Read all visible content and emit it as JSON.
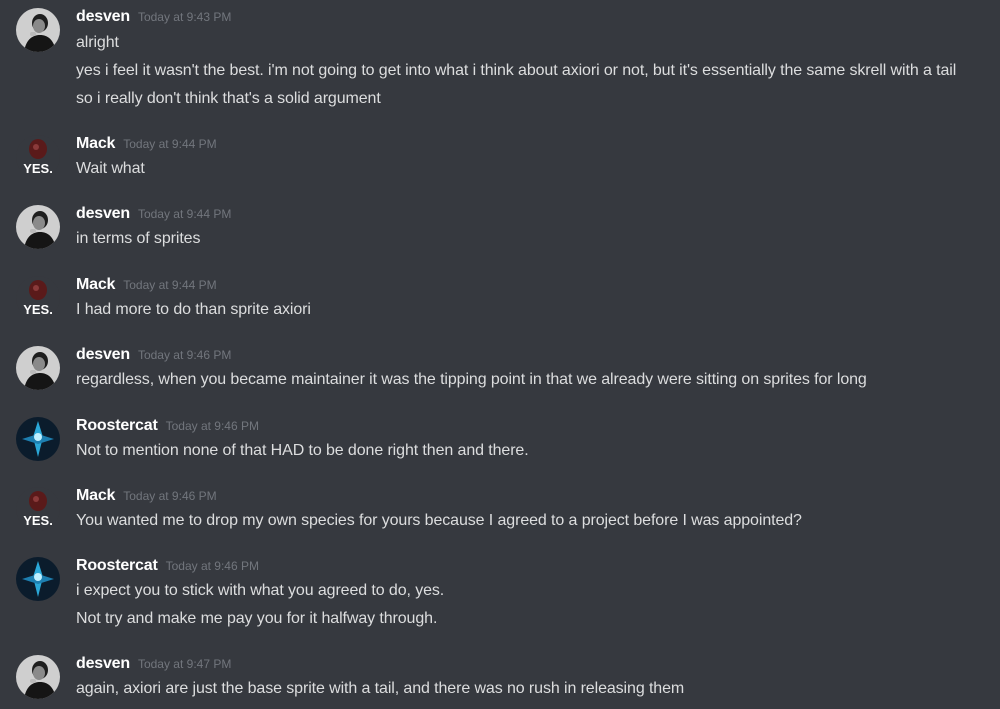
{
  "colors": {
    "background": "#36393f",
    "username": "#ffffff",
    "timestamp": "#72767d",
    "message_text": "#dcddde"
  },
  "messages": [
    {
      "author": "desven",
      "avatar_icon": "desven-avatar-icon",
      "timestamp": "Today at 9:43 PM",
      "lines": [
        "alright",
        "yes i feel it wasn't the best. i'm not going to get into what i think about axiori or not, but it's essentially the same skrell with a tail",
        "so i really don't think that's a solid argument"
      ]
    },
    {
      "author": "Mack",
      "avatar_icon": "mack-avatar-icon",
      "avatar_text": "YES.",
      "timestamp": "Today at 9:44 PM",
      "lines": [
        "Wait what"
      ]
    },
    {
      "author": "desven",
      "avatar_icon": "desven-avatar-icon",
      "timestamp": "Today at 9:44 PM",
      "lines": [
        "in terms of sprites"
      ]
    },
    {
      "author": "Mack",
      "avatar_icon": "mack-avatar-icon",
      "avatar_text": "YES.",
      "timestamp": "Today at 9:44 PM",
      "lines": [
        "I had more to do than sprite axiori"
      ]
    },
    {
      "author": "desven",
      "avatar_icon": "desven-avatar-icon",
      "timestamp": "Today at 9:46 PM",
      "lines": [
        "regardless, when you became maintainer it was the tipping point in that we already were sitting on sprites for long"
      ]
    },
    {
      "author": "Roostercat",
      "avatar_icon": "roostercat-avatar-icon",
      "timestamp": "Today at 9:46 PM",
      "lines": [
        "Not to mention none of that HAD to be done right then and there."
      ]
    },
    {
      "author": "Mack",
      "avatar_icon": "mack-avatar-icon",
      "avatar_text": "YES.",
      "timestamp": "Today at 9:46 PM",
      "lines": [
        "You wanted me to drop my own species for yours because I agreed to a project before I was appointed?"
      ]
    },
    {
      "author": "Roostercat",
      "avatar_icon": "roostercat-avatar-icon",
      "timestamp": "Today at 9:46 PM",
      "lines": [
        "i expect you to stick with what you agreed to do, yes.",
        "Not try and make me pay you for it halfway through."
      ]
    },
    {
      "author": "desven",
      "avatar_icon": "desven-avatar-icon",
      "timestamp": "Today at 9:47 PM",
      "lines": [
        "again, axiori are just the base sprite with a tail, and there was no rush in releasing them"
      ]
    }
  ]
}
